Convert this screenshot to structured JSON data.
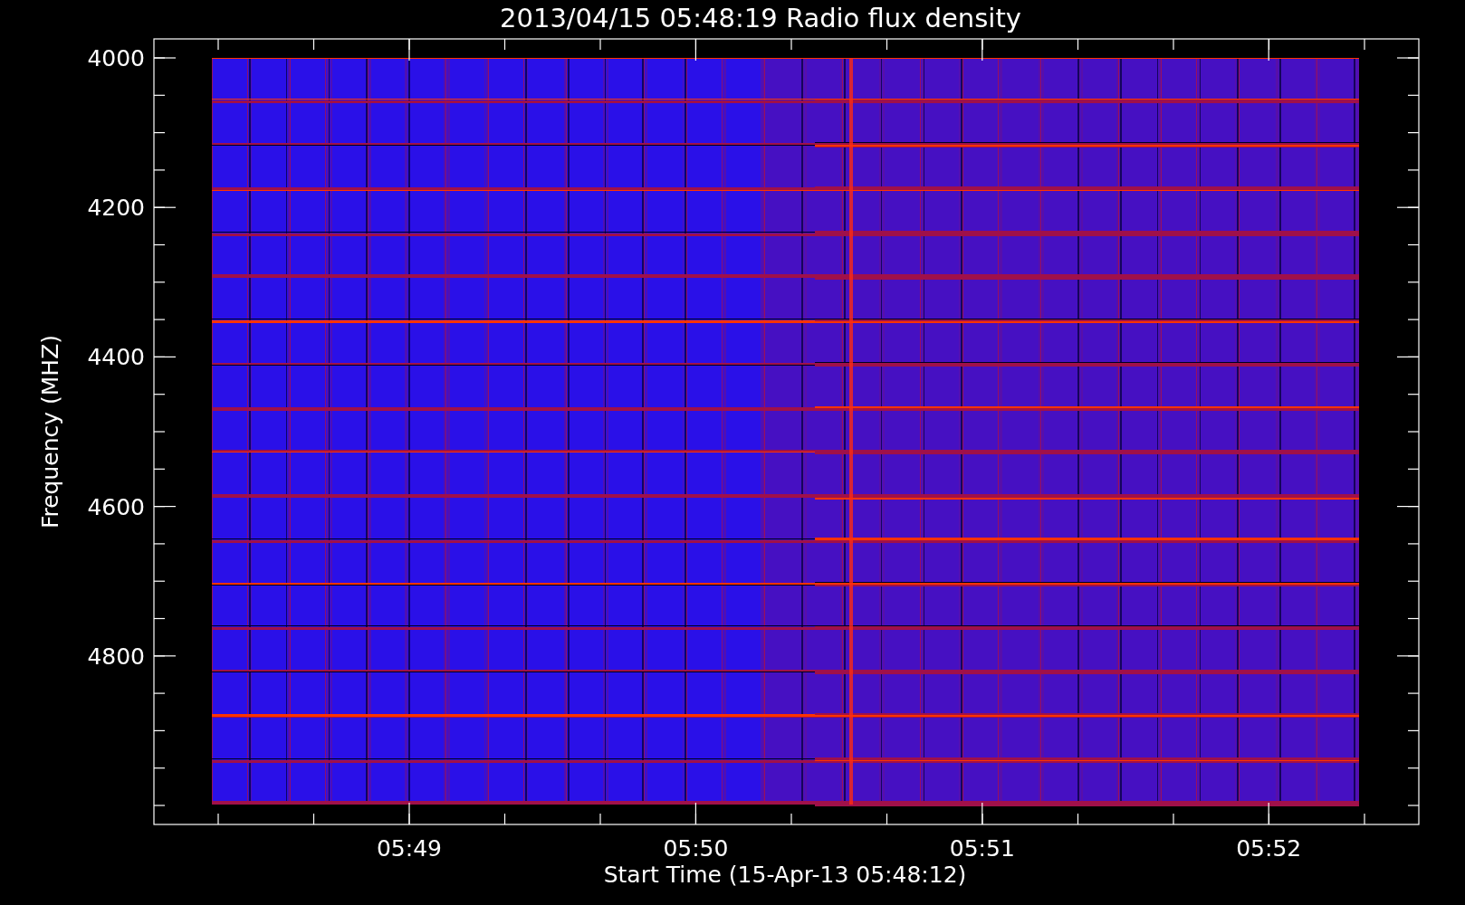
{
  "plot": {
    "title": "2013/04/15 05:48:19 Radio flux density",
    "y_axis": {
      "label": "Frequency (MHZ)",
      "ticks": [
        "4000",
        "4200",
        "4400",
        "4600",
        "4800"
      ]
    },
    "x_axis": {
      "label": "Start Time (15-Apr-13 05:48:12)",
      "ticks": [
        "05:49",
        "05:50",
        "05:51",
        "05:52"
      ]
    }
  }
}
